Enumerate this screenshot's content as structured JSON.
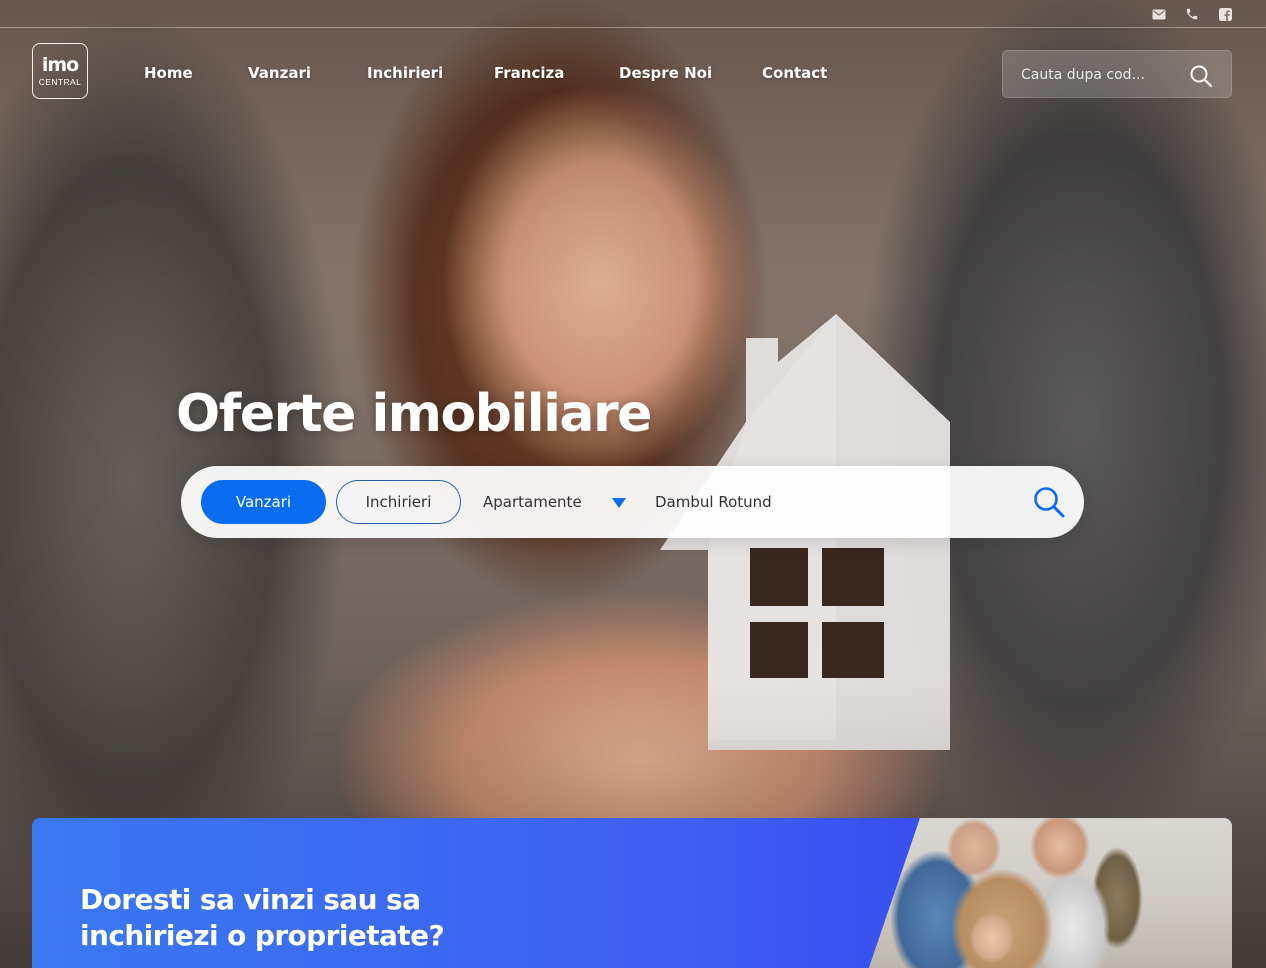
{
  "logo": {
    "main": "imo",
    "sub": "CENTRAL"
  },
  "topbar": {
    "icons": [
      "email-icon",
      "phone-icon",
      "facebook-icon"
    ]
  },
  "nav": {
    "items": [
      {
        "label": "Home"
      },
      {
        "label": "Vanzari"
      },
      {
        "label": "Inchirieri"
      },
      {
        "label": "Franciza"
      },
      {
        "label": "Despre Noi"
      },
      {
        "label": "Contact"
      }
    ]
  },
  "code_search": {
    "placeholder": "Cauta dupa cod...",
    "icon": "search-icon"
  },
  "hero": {
    "title": "Oferte imobiliare"
  },
  "search": {
    "tab_sale": "Vanzari",
    "tab_rent": "Inchirieri",
    "property_type": "Apartamente",
    "location": "Dambul Rotund",
    "accent": "#0a6cf0"
  },
  "cta": {
    "title_line1": "Doresti sa vinzi sau sa",
    "title_line2": "inchiriezi o proprietate?",
    "gradient": [
      "#3a78f2",
      "#2f3cf0"
    ]
  }
}
